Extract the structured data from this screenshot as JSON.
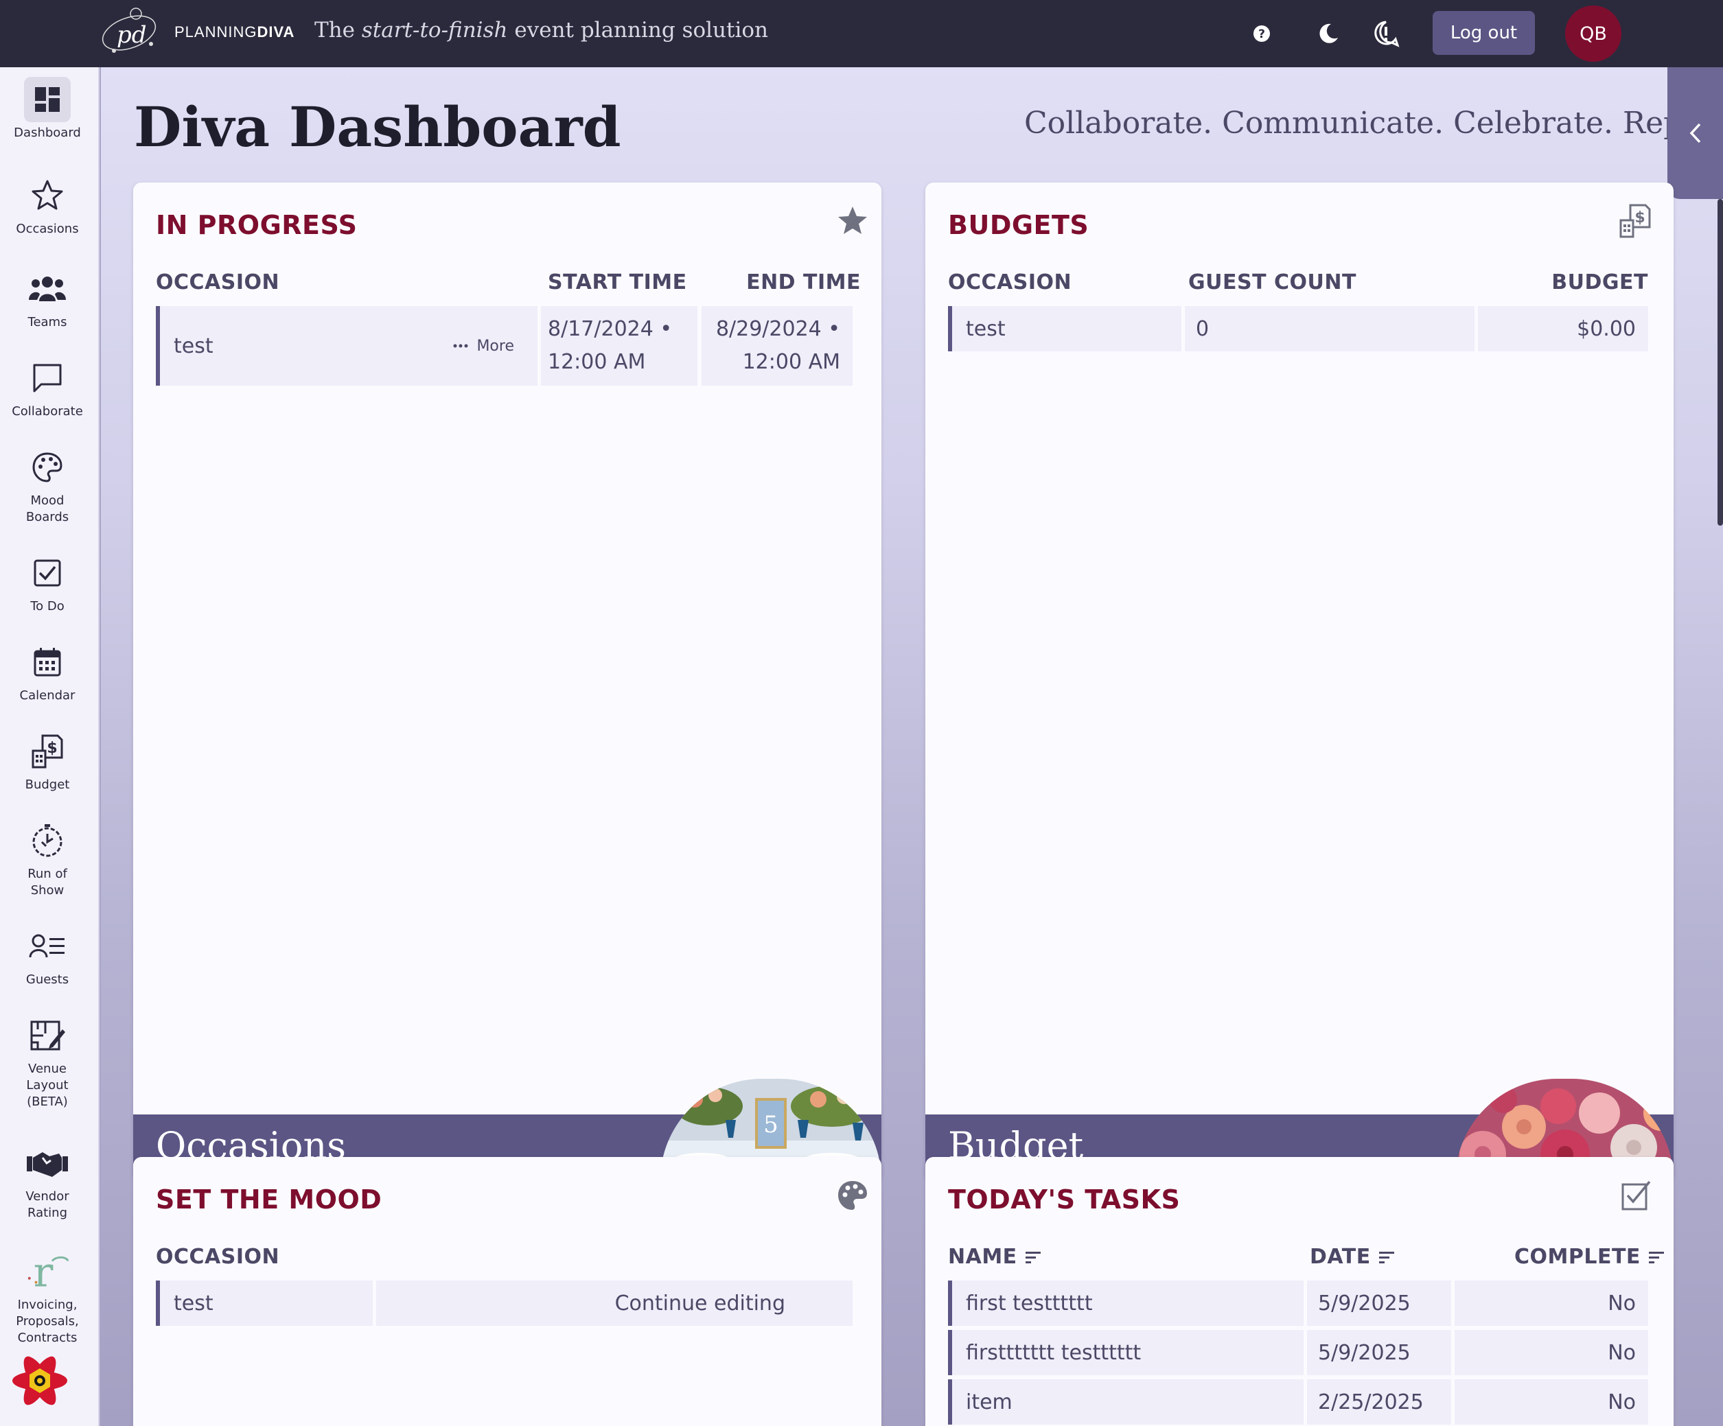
{
  "topbar": {
    "brand_light": "PLANNING",
    "brand_bold": "DIVA",
    "tagline_pre": "The ",
    "tagline_em": "start-to-finish",
    "tagline_post": " event planning solution",
    "logout_label": "Log out",
    "avatar_initials": "QB",
    "icons": [
      "help-icon",
      "dark-mode-moon-icon",
      "feedback-icon"
    ]
  },
  "sidebar": {
    "items": [
      {
        "label": "Dashboard",
        "icon": "dashboard-icon"
      },
      {
        "label": "Occasions",
        "icon": "star-icon"
      },
      {
        "label": "Teams",
        "icon": "users-icon"
      },
      {
        "label": "Collaborate",
        "icon": "chat-icon"
      },
      {
        "label": "Mood Boards",
        "icon": "palette-icon"
      },
      {
        "label": "To Do",
        "icon": "checkbox-icon"
      },
      {
        "label": "Calendar",
        "icon": "calendar-icon"
      },
      {
        "label": "Budget",
        "icon": "budget-icon"
      },
      {
        "label": "Run of Show",
        "icon": "stopwatch-icon"
      },
      {
        "label": "Guests",
        "icon": "guest-list-icon"
      },
      {
        "label": "Venue Layout (BETA)",
        "icon": "venue-layout-icon"
      },
      {
        "label": "Vendor Rating",
        "icon": "handshake-icon"
      },
      {
        "label": "Invoicing, Proposals, Contracts",
        "icon": "invoicing-logo-icon"
      }
    ]
  },
  "main": {
    "title": "Diva Dashboard",
    "tagline": "Collaborate. Communicate. Celebrate. Repeat"
  },
  "in_progress": {
    "title": "IN PROGRESS",
    "headers": {
      "occasion": "OCCASION",
      "start": "START TIME",
      "end": "END TIME"
    },
    "rows": [
      {
        "occasion": "test",
        "more": "More",
        "start_date": "8/17/2024 •",
        "start_time": "12:00 AM",
        "end_date": "8/29/2024 •",
        "end_time": "12:00 AM"
      }
    ],
    "footer": "Occasions"
  },
  "budgets": {
    "title": "BUDGETS",
    "headers": {
      "occasion": "OCCASION",
      "guests": "GUEST COUNT",
      "budget": "BUDGET"
    },
    "rows": [
      {
        "occasion": "test",
        "guests": "0",
        "budget": "$0.00"
      }
    ],
    "footer": "Budget"
  },
  "mood": {
    "title": "SET THE MOOD",
    "headers": {
      "occasion": "OCCASION"
    },
    "rows": [
      {
        "occasion": "test",
        "action": "Continue editing"
      }
    ]
  },
  "tasks": {
    "title": "TODAY'S TASKS",
    "headers": {
      "name": "NAME",
      "date": "DATE",
      "complete": "COMPLETE"
    },
    "rows": [
      {
        "name": "first testttttt",
        "date": "5/9/2025",
        "complete": "No"
      },
      {
        "name": "firsttttttt testttttt",
        "date": "5/9/2025",
        "complete": "No"
      },
      {
        "name": "item",
        "date": "2/25/2025",
        "complete": "No"
      }
    ]
  },
  "colors": {
    "topbar": "#2b2a3d",
    "accent": "#5b5684",
    "card_title": "#7d0e2e",
    "avatar": "#7d0e2e"
  }
}
